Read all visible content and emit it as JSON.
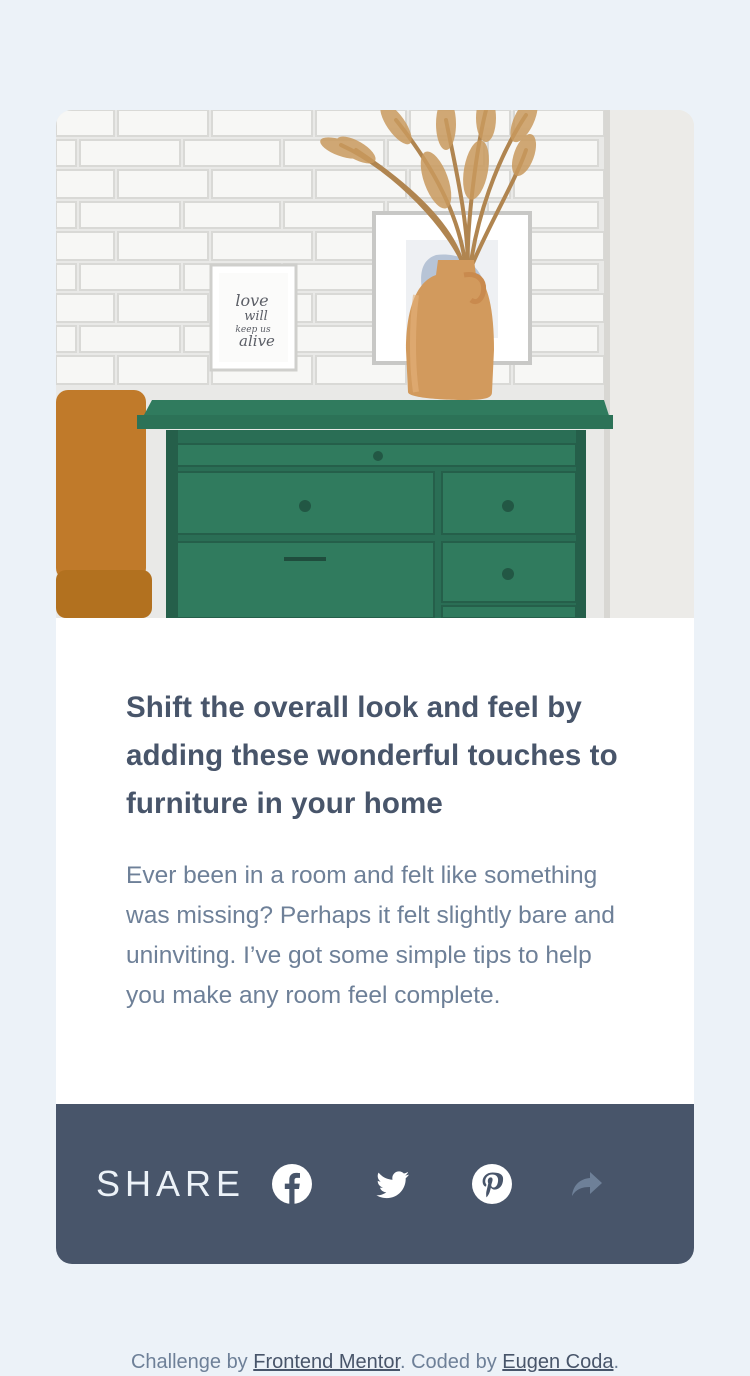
{
  "article": {
    "image_alt": "Green drawers with a vase of dried grass and framed prints",
    "frame_text": [
      "love",
      "will",
      "keep us",
      "alive"
    ],
    "headline": "Shift the overall look and feel by adding these wonderful touches to furniture in your home",
    "excerpt": "Ever been in a room and felt like something was missing? Perhaps it felt slightly bare and uninviting. I’ve got some simple tips to help you make any room feel complete."
  },
  "share": {
    "label": "SHARE",
    "icons": [
      "facebook-icon",
      "twitter-icon",
      "pinterest-icon",
      "share-arrow-icon"
    ]
  },
  "attribution": {
    "prefix": "Challenge by ",
    "link1": "Frontend Mentor",
    "middle": ". Coded by ",
    "link2": "Eugen Coda",
    "suffix": "."
  },
  "colors": {
    "background": "#ecf2f8",
    "card": "#ffffff",
    "heading": "#48556a",
    "body_text": "#6e8098",
    "share_bar": "#48556a",
    "share_arrow": "#6e8098",
    "drawer_green": "#2f7a5e"
  }
}
